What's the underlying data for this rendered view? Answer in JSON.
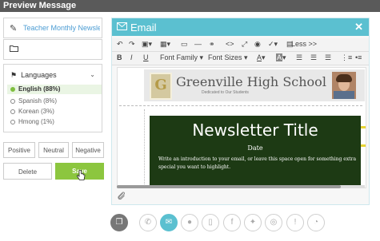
{
  "window": {
    "title": "Preview Message",
    "close_glyph": "✕"
  },
  "left": {
    "subject_icon": "edit-icon",
    "subject": "Teacher Monthly Newsletter",
    "folder_icon": "folder-icon",
    "languages": {
      "header": "Languages",
      "items": [
        {
          "label": "English (88%)",
          "selected": true
        },
        {
          "label": "Spanish (8%)",
          "selected": false
        },
        {
          "label": "Korean (3%)",
          "selected": false
        },
        {
          "label": "Hmong (1%)",
          "selected": false
        }
      ]
    },
    "sentiment": {
      "positive": "Positive",
      "neutral": "Neutral",
      "negative": "Negative"
    },
    "delete_label": "Delete",
    "save_label": "Save"
  },
  "email": {
    "title": "Email",
    "close_glyph": "✕",
    "toolbar": {
      "font_family": "Font Family",
      "font_sizes": "Font Sizes",
      "less": "Less >>"
    },
    "newsletter": {
      "logo_letter": "G",
      "school": "Greenville High School",
      "tagline": "Dedicated to Our Students",
      "title": "Newsletter Title",
      "date": "Date",
      "intro": "Write an introduction to your email, or leave this space open for something extra special you want to highlight."
    }
  },
  "channels": [
    "copy-icon",
    "phone-icon",
    "email-icon",
    "chat-icon",
    "mobile-icon",
    "facebook-icon",
    "twitter-icon",
    "web-icon",
    "alert-icon",
    "rss-icon"
  ],
  "colors": {
    "accent": "#5bc0d0",
    "save": "#8cc63f",
    "board": "#1d3a14",
    "titlebar": "#5a5a5a"
  }
}
